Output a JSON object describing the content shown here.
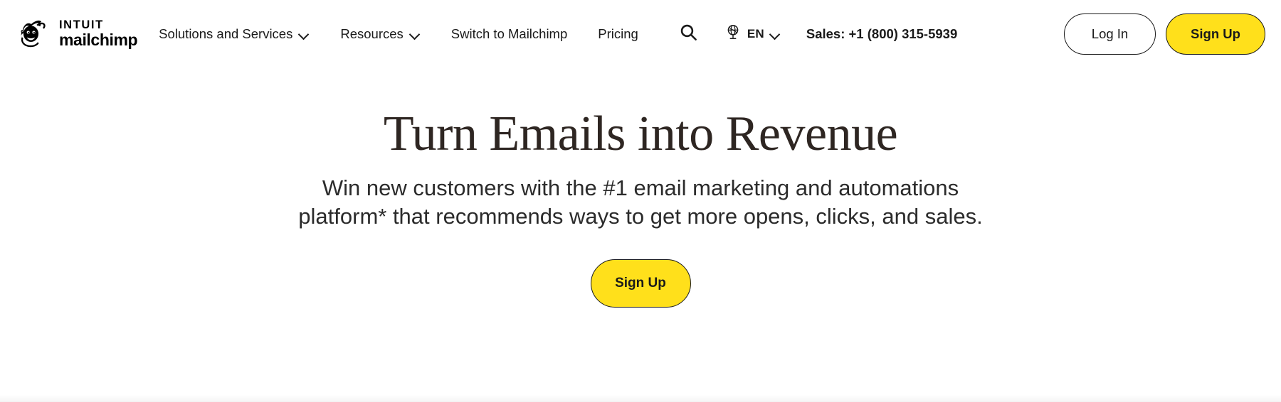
{
  "brand": {
    "accent_yellow": "#FFE01B",
    "text_dark": "#1a1a1a",
    "heading_color": "#2E2622",
    "logo_line1": "INTUIT",
    "logo_line2": "mailchimp",
    "logo_alt": "Intuit Mailchimp"
  },
  "header": {
    "nav": [
      {
        "label": "Solutions and Services",
        "has_chevron": true,
        "name": "solutions-and-services"
      },
      {
        "label": "Resources",
        "has_chevron": true,
        "name": "resources"
      },
      {
        "label": "Switch to Mailchimp",
        "has_chevron": false,
        "name": "switch-to-mailchimp"
      },
      {
        "label": "Pricing",
        "has_chevron": false,
        "name": "pricing"
      }
    ],
    "search_icon": "search-icon",
    "language": {
      "icon": "globe-icon",
      "label": "EN",
      "chevron": "chevron-down-icon"
    },
    "sales": "Sales: +1 (800) 315-5939",
    "login_label": "Log In",
    "signup_label": "Sign Up"
  },
  "hero": {
    "title": "Turn Emails into Revenue",
    "subtitle": "Win new customers with the #1 email marketing and automations platform* that recommends ways to get more opens, clicks, and sales.",
    "cta_label": "Sign Up"
  }
}
